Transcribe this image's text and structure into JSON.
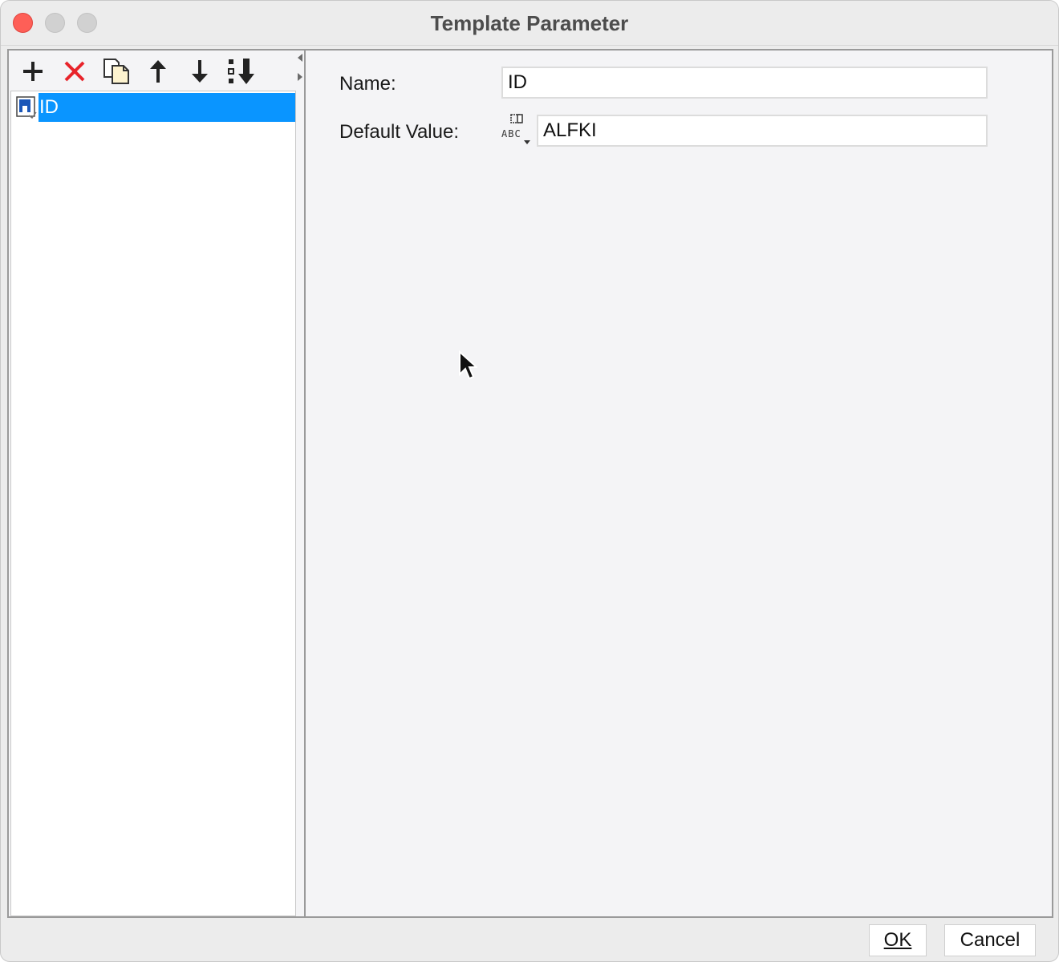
{
  "window": {
    "title": "Template Parameter"
  },
  "toolbar": {
    "buttons": [
      {
        "name": "add-icon",
        "tooltip": ""
      },
      {
        "name": "delete-icon",
        "tooltip": ""
      },
      {
        "name": "copy-icon",
        "tooltip": ""
      },
      {
        "name": "move-up-icon",
        "tooltip": ""
      },
      {
        "name": "move-down-icon",
        "tooltip": ""
      },
      {
        "name": "sort-icon",
        "tooltip": ""
      }
    ]
  },
  "tree": {
    "items": [
      {
        "label": "ID",
        "selected": true,
        "icon": "parameter-icon"
      }
    ]
  },
  "form": {
    "name_label": "Name:",
    "name_value": "ID",
    "default_label": "Default Value:",
    "default_value": "ALFKI",
    "type_icon": "string-type-icon"
  },
  "footer": {
    "ok_label": "OK",
    "cancel_label": "Cancel"
  },
  "colors": {
    "selection": "#0a95ff",
    "delete": "#e8232a",
    "close_button": "#fe5f57"
  }
}
